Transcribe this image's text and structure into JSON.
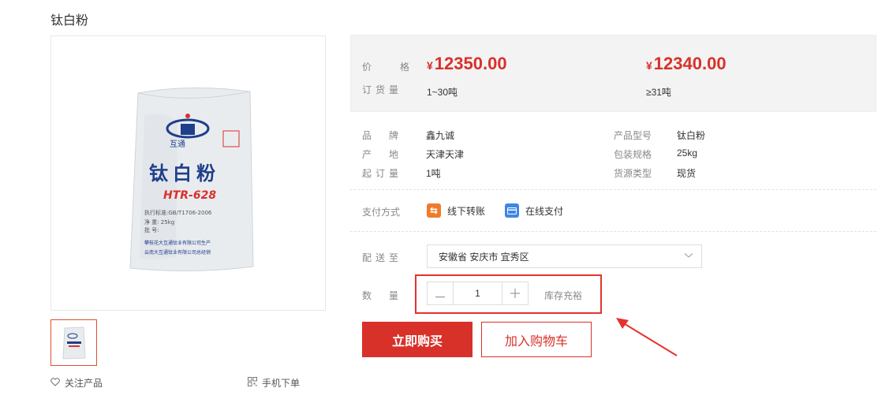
{
  "product": {
    "title": "钛白粉",
    "bag": {
      "brand_mark": "互通",
      "name": "钛白粉",
      "model": "HTR-628",
      "std": "执行标准:GB/T1706-2006",
      "weight": "净 重: 25kg",
      "batch": "批 号:",
      "maker1": "攀枝花大互通钛业有限公司生产",
      "maker2": "云南大互通钛业有限公司总经销"
    },
    "follow_label": "关注产品",
    "mobile_label": "手机下单"
  },
  "prices": {
    "price_label": "价　格",
    "qty_label": "订货量",
    "currency": "¥",
    "tiers": [
      {
        "price": "12350.00",
        "range": "1~30吨"
      },
      {
        "price": "12340.00",
        "range": "≥31吨"
      }
    ]
  },
  "attrs": {
    "left": [
      {
        "label": "品　牌",
        "value": "鑫九诚"
      },
      {
        "label": "产　地",
        "value": "天津天津"
      },
      {
        "label": "起订量",
        "value": "1吨"
      }
    ],
    "right": [
      {
        "label": "产品型号",
        "value": "钛白粉"
      },
      {
        "label": "包装规格",
        "value": "25kg"
      },
      {
        "label": "货源类型",
        "value": "现货"
      }
    ]
  },
  "payment": {
    "label": "支付方式",
    "options": [
      "线下转账",
      "在线支付"
    ]
  },
  "delivery": {
    "label": "配送至",
    "value": "安徽省 安庆市 宜秀区"
  },
  "quantity": {
    "label": "数　量",
    "value": "1",
    "stock": "库存充裕"
  },
  "actions": {
    "buy": "立即购买",
    "cart": "加入购物车"
  },
  "colors": {
    "accent": "#d8312a",
    "highlight": "#e3342d",
    "price_bg": "#f3f3f3"
  }
}
